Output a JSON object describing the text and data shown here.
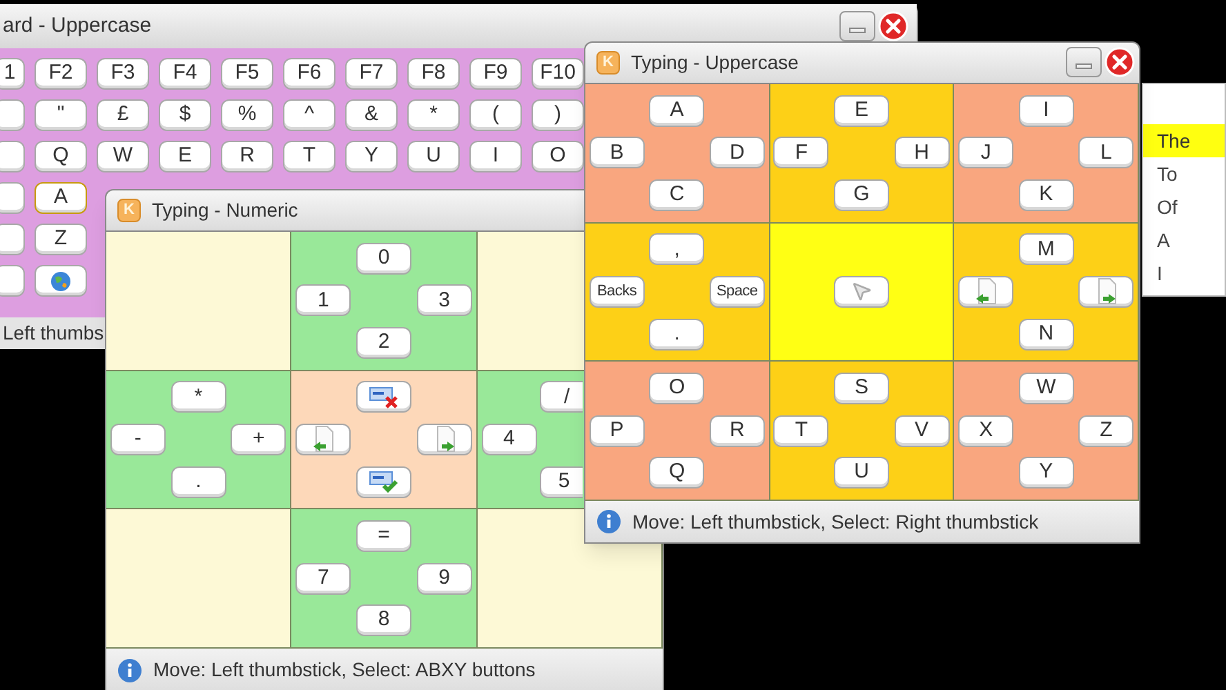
{
  "keyboard_window": {
    "title": "ard - Uppercase",
    "rows": [
      [
        {
          "kind": "text",
          "label": "1",
          "selected": false
        },
        {
          "kind": "text",
          "label": "F2",
          "selected": false
        },
        {
          "kind": "text",
          "label": "F3",
          "selected": false
        },
        {
          "kind": "text",
          "label": "F4",
          "selected": false
        },
        {
          "kind": "text",
          "label": "F5",
          "selected": false
        },
        {
          "kind": "text",
          "label": "F6",
          "selected": false
        },
        {
          "kind": "text",
          "label": "F7",
          "selected": false
        },
        {
          "kind": "text",
          "label": "F8",
          "selected": false
        },
        {
          "kind": "text",
          "label": "F9",
          "selected": false
        },
        {
          "kind": "text",
          "label": "F10",
          "selected": false
        }
      ],
      [
        {
          "kind": "blank",
          "selected": false
        },
        {
          "kind": "text",
          "label": "\"",
          "selected": false
        },
        {
          "kind": "text",
          "label": "£",
          "selected": false
        },
        {
          "kind": "text",
          "label": "$",
          "selected": false
        },
        {
          "kind": "text",
          "label": "%",
          "selected": false
        },
        {
          "kind": "text",
          "label": "^",
          "selected": false
        },
        {
          "kind": "text",
          "label": "&",
          "selected": false
        },
        {
          "kind": "text",
          "label": "*",
          "selected": false
        },
        {
          "kind": "text",
          "label": "(",
          "selected": false
        },
        {
          "kind": "text",
          "label": ")",
          "selected": false
        }
      ],
      [
        {
          "kind": "blank",
          "selected": false
        },
        {
          "kind": "text",
          "label": "Q",
          "selected": false
        },
        {
          "kind": "text",
          "label": "W",
          "selected": false
        },
        {
          "kind": "text",
          "label": "E",
          "selected": false
        },
        {
          "kind": "text",
          "label": "R",
          "selected": false
        },
        {
          "kind": "text",
          "label": "T",
          "selected": false
        },
        {
          "kind": "text",
          "label": "Y",
          "selected": false
        },
        {
          "kind": "text",
          "label": "U",
          "selected": false
        },
        {
          "kind": "text",
          "label": "I",
          "selected": false
        },
        {
          "kind": "text",
          "label": "O",
          "selected": false
        }
      ],
      [
        {
          "kind": "blank",
          "selected": false
        },
        {
          "kind": "text",
          "label": "A",
          "selected": true
        }
      ],
      [
        {
          "kind": "blank",
          "selected": false
        },
        {
          "kind": "text",
          "label": "Z",
          "selected": false
        }
      ],
      [
        {
          "kind": "blank",
          "selected": false
        },
        {
          "kind": "globe",
          "selected": false
        }
      ]
    ],
    "status": "Left thumbs"
  },
  "numeric_window": {
    "icon_letter": "K",
    "title": "Typing - Numeric",
    "cells": [
      {
        "color": "#fdf9d6"
      },
      {
        "color": "#99e899",
        "top": {
          "kind": "text",
          "label": "0"
        },
        "left": {
          "kind": "text",
          "label": "1"
        },
        "right": {
          "kind": "text",
          "label": "3"
        },
        "bottom": {
          "kind": "text",
          "label": "2"
        }
      },
      {
        "color": "#fdf9d6"
      },
      {
        "color": "#99e899",
        "top": {
          "kind": "text",
          "label": "*"
        },
        "left": {
          "kind": "text",
          "label": "-"
        },
        "right": {
          "kind": "text",
          "label": "+"
        },
        "bottom": {
          "kind": "text",
          "label": "."
        }
      },
      {
        "color": "#fdd8b9",
        "top": {
          "kind": "delete-word"
        },
        "left": {
          "kind": "previous"
        },
        "right": {
          "kind": "next"
        },
        "bottom": {
          "kind": "accept-word"
        }
      },
      {
        "color": "#99e899",
        "top": {
          "kind": "text",
          "label": "/"
        },
        "left": {
          "kind": "text",
          "label": "4"
        },
        "bottom": {
          "kind": "text",
          "label": "5"
        }
      },
      {
        "color": "#fdf9d6"
      },
      {
        "color": "#99e899",
        "top": {
          "kind": "text",
          "label": "="
        },
        "left": {
          "kind": "text",
          "label": "7"
        },
        "right": {
          "kind": "text",
          "label": "9"
        },
        "bottom": {
          "kind": "text",
          "label": "8"
        }
      },
      {
        "color": "#fdf9d6"
      }
    ],
    "status": "Move: Left thumbstick, Select: ABXY buttons"
  },
  "uppercase_window": {
    "icon_letter": "K",
    "title": "Typing - Uppercase",
    "cells": [
      {
        "color": "#f9a67f",
        "top": {
          "kind": "text",
          "label": "A"
        },
        "left": {
          "kind": "text",
          "label": "B"
        },
        "right": {
          "kind": "text",
          "label": "D"
        },
        "bottom": {
          "kind": "text",
          "label": "C"
        }
      },
      {
        "color": "#fdd017",
        "top": {
          "kind": "text",
          "label": "E"
        },
        "left": {
          "kind": "text",
          "label": "F"
        },
        "right": {
          "kind": "text",
          "label": "H"
        },
        "bottom": {
          "kind": "text",
          "label": "G"
        }
      },
      {
        "color": "#f9a67f",
        "top": {
          "kind": "text",
          "label": "I"
        },
        "left": {
          "kind": "text",
          "label": "J"
        },
        "right": {
          "kind": "text",
          "label": "L"
        },
        "bottom": {
          "kind": "text",
          "label": "K"
        }
      },
      {
        "color": "#fdd017",
        "top": {
          "kind": "text",
          "label": ","
        },
        "left": {
          "kind": "small",
          "label": "Backs"
        },
        "right": {
          "kind": "small",
          "label": "Space"
        },
        "bottom": {
          "kind": "text",
          "label": "."
        }
      },
      {
        "color": "#ffff14",
        "center": {
          "kind": "cursor"
        }
      },
      {
        "color": "#fdd017",
        "top": {
          "kind": "text",
          "label": "M"
        },
        "left": {
          "kind": "previous"
        },
        "right": {
          "kind": "next"
        },
        "bottom": {
          "kind": "text",
          "label": "N"
        }
      },
      {
        "color": "#f9a67f",
        "top": {
          "kind": "text",
          "label": "O"
        },
        "left": {
          "kind": "text",
          "label": "P"
        },
        "right": {
          "kind": "text",
          "label": "R"
        },
        "bottom": {
          "kind": "text",
          "label": "Q"
        }
      },
      {
        "color": "#fdd017",
        "top": {
          "kind": "text",
          "label": "S"
        },
        "left": {
          "kind": "text",
          "label": "T"
        },
        "right": {
          "kind": "text",
          "label": "V"
        },
        "bottom": {
          "kind": "text",
          "label": "U"
        }
      },
      {
        "color": "#f9a67f",
        "top": {
          "kind": "text",
          "label": "W"
        },
        "left": {
          "kind": "text",
          "label": "X"
        },
        "right": {
          "kind": "text",
          "label": "Z"
        },
        "bottom": {
          "kind": "text",
          "label": "Y"
        }
      }
    ],
    "status": "Move: Left thumbstick, Select: Right thumbstick"
  },
  "word_list": [
    {
      "label": "The",
      "selected": true
    },
    {
      "label": "To",
      "selected": false
    },
    {
      "label": "Of",
      "selected": false
    },
    {
      "label": "A",
      "selected": false
    },
    {
      "label": "I",
      "selected": false
    }
  ]
}
